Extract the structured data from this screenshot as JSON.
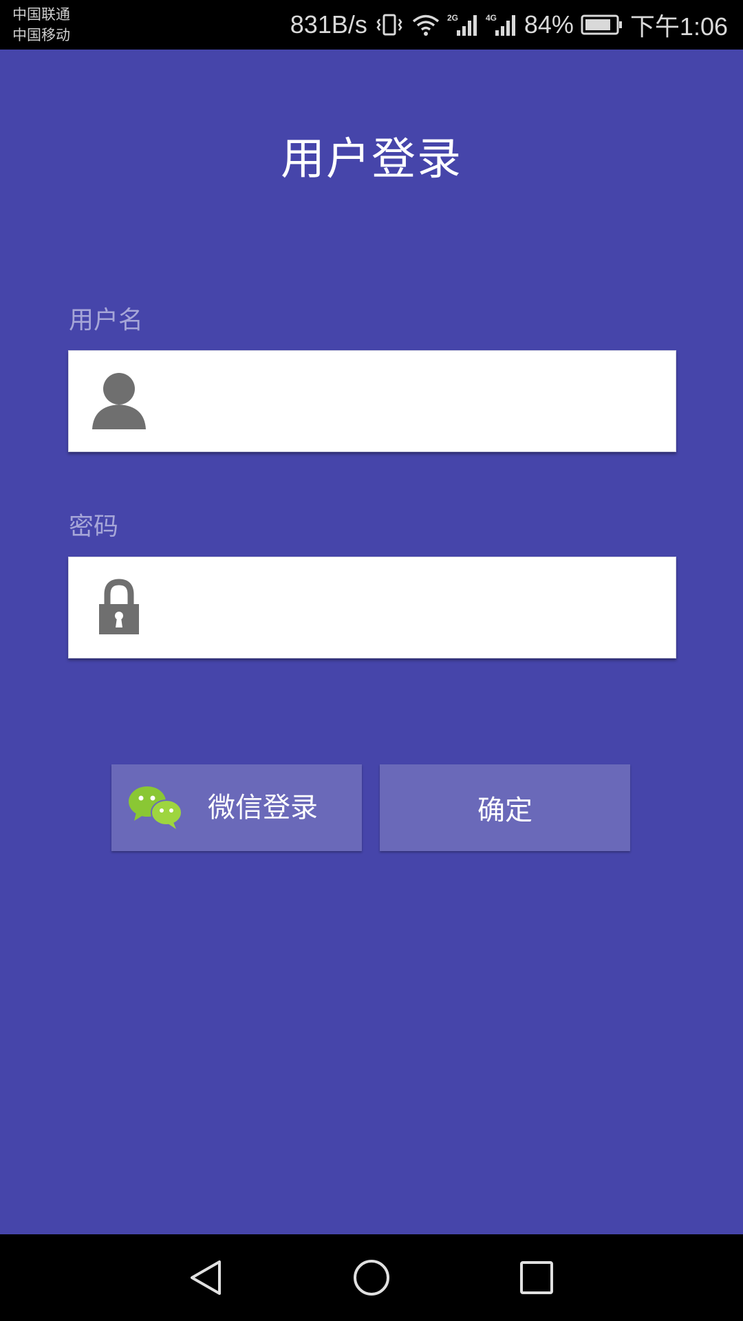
{
  "status_bar": {
    "carrier_1": "中国联通",
    "carrier_2": "中国移动",
    "network_speed": "831B/s",
    "signal_1_type": "2G",
    "signal_2_type": "4G",
    "battery": "84%",
    "time": "下午1:06",
    "icons": [
      "vibrate-icon",
      "wifi-icon",
      "signal-2g-icon",
      "signal-4g-icon",
      "battery-icon"
    ]
  },
  "page": {
    "title": "用户登录"
  },
  "username": {
    "label": "用户名",
    "value": "",
    "icon": "user-icon"
  },
  "password": {
    "label": "密码",
    "value": "",
    "icon": "lock-icon"
  },
  "buttons": {
    "wechat_login": "微信登录",
    "wechat_icon": "wechat-icon",
    "confirm": "确定"
  },
  "navigation": {
    "items": [
      "back-icon",
      "home-icon",
      "recents-icon"
    ]
  },
  "colors": {
    "background": "#4645aa",
    "button": "#6a69b9",
    "label": "#a6a6d8",
    "icon_gray": "#6f6f6f",
    "wechat_green": "#8ac734"
  }
}
